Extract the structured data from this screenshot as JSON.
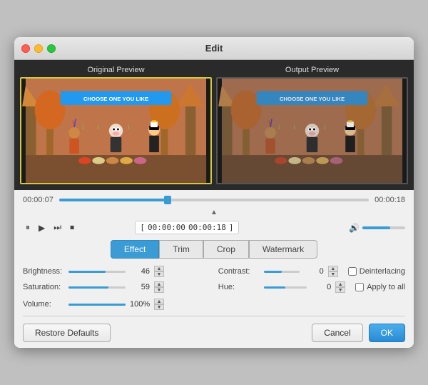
{
  "window": {
    "title": "Edit"
  },
  "preview": {
    "original_label": "Original Preview",
    "output_label": "Output Preview",
    "banner_text": "CHOOSE ONE YOU LIKE"
  },
  "timeline": {
    "start_time": "00:00:07",
    "end_time": "00:00:18",
    "range_start": "00:00:00",
    "range_end": "00:00:18",
    "fill_percent": "35%",
    "volume_fill": "65%"
  },
  "transport": {
    "pause_label": "⏸",
    "play_label": "▶",
    "skip_label": "⏭",
    "stop_label": "⏹",
    "bracket_open": "[",
    "bracket_close": "]"
  },
  "tabs": [
    {
      "id": "effect",
      "label": "Effect",
      "active": true
    },
    {
      "id": "trim",
      "label": "Trim",
      "active": false
    },
    {
      "id": "crop",
      "label": "Crop",
      "active": false
    },
    {
      "id": "watermark",
      "label": "Watermark",
      "active": false
    }
  ],
  "params": {
    "brightness": {
      "label": "Brightness:",
      "value": "46",
      "fill": "65%"
    },
    "contrast": {
      "label": "Contrast:",
      "value": "0",
      "fill": "50%"
    },
    "saturation": {
      "label": "Saturation:",
      "value": "59",
      "fill": "70%"
    },
    "hue": {
      "label": "Hue:",
      "value": "0",
      "fill": "50%"
    },
    "volume": {
      "label": "Volume:",
      "value": "100%",
      "fill": "100%"
    },
    "deinterlacing_label": "Deinterlacing",
    "apply_to_all_label": "Apply to all"
  },
  "footer": {
    "restore_defaults": "Restore Defaults",
    "cancel": "Cancel",
    "ok": "OK"
  }
}
